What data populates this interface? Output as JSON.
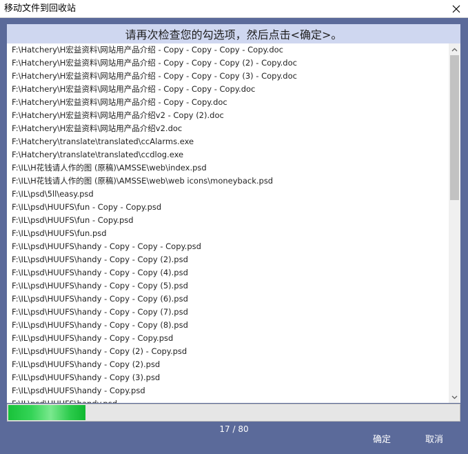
{
  "window": {
    "title": "移动文件到回收站"
  },
  "header": {
    "message": "请再次检查您的勾选项，然后点击<确定>。"
  },
  "files": [
    "F:\\Hatchery\\H宏益资料\\网站用产品介绍 - Copy - Copy - Copy - Copy.doc",
    "F:\\Hatchery\\H宏益资料\\网站用产品介绍 - Copy - Copy - Copy (2) - Copy.doc",
    "F:\\Hatchery\\H宏益资料\\网站用产品介绍 - Copy - Copy - Copy (3) - Copy.doc",
    "F:\\Hatchery\\H宏益资料\\网站用产品介绍 - Copy - Copy - Copy.doc",
    "F:\\Hatchery\\H宏益资料\\网站用产品介绍 - Copy - Copy.doc",
    "F:\\Hatchery\\H宏益资料\\网站用产品介绍v2 - Copy (2).doc",
    "F:\\Hatchery\\H宏益资料\\网站用产品介绍v2.doc",
    "F:\\Hatchery\\translate\\translated\\ccAlarms.exe",
    "F:\\Hatchery\\translate\\translated\\ccdlog.exe",
    "F:\\IL\\H花钱请人作的图 (原稿)\\AMSSE\\web\\index.psd",
    "F:\\IL\\H花钱请人作的图 (原稿)\\AMSSE\\web\\web icons\\moneyback.psd",
    "F:\\IL\\psd\\5ll\\easy.psd",
    "F:\\IL\\psd\\HUUFS\\fun - Copy - Copy.psd",
    "F:\\IL\\psd\\HUUFS\\fun - Copy.psd",
    "F:\\IL\\psd\\HUUFS\\fun.psd",
    "F:\\IL\\psd\\HUUFS\\handy - Copy - Copy - Copy.psd",
    "F:\\IL\\psd\\HUUFS\\handy - Copy - Copy (2).psd",
    "F:\\IL\\psd\\HUUFS\\handy - Copy - Copy (4).psd",
    "F:\\IL\\psd\\HUUFS\\handy - Copy - Copy (5).psd",
    "F:\\IL\\psd\\HUUFS\\handy - Copy - Copy (6).psd",
    "F:\\IL\\psd\\HUUFS\\handy - Copy - Copy (7).psd",
    "F:\\IL\\psd\\HUUFS\\handy - Copy - Copy (8).psd",
    "F:\\IL\\psd\\HUUFS\\handy - Copy - Copy.psd",
    "F:\\IL\\psd\\HUUFS\\handy - Copy (2) - Copy.psd",
    "F:\\IL\\psd\\HUUFS\\handy - Copy (2).psd",
    "F:\\IL\\psd\\HUUFS\\handy - Copy (3).psd",
    "F:\\IL\\psd\\HUUFS\\handy - Copy.psd",
    "F:\\IL\\psd\\HUUFS\\handy.psd"
  ],
  "progress": {
    "current": 17,
    "total": 80,
    "label": "17 / 80",
    "fraction": 0.17
  },
  "buttons": {
    "ok": "确定",
    "cancel": "取消"
  },
  "colors": {
    "background": "#5b6a9a",
    "header_bar": "#cfd7f0",
    "progress_fill": "#2ccb4c"
  },
  "icons": {
    "close": "close-icon",
    "scroll_up": "chevron-up-icon",
    "scroll_down": "chevron-down-icon"
  }
}
